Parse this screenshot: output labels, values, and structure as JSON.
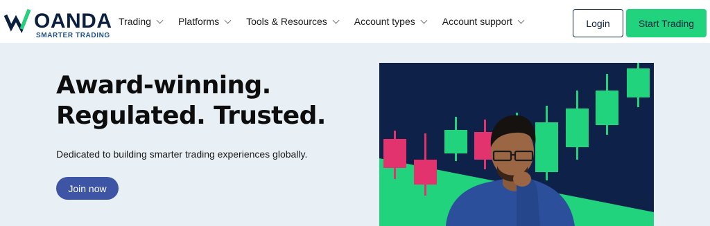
{
  "brand": {
    "name": "OANDA",
    "tagline": "SMARTER TRADING",
    "colors": {
      "navy": "#0b1f3f",
      "green": "#20d37c",
      "pink": "#e3336f",
      "join": "#3d55a4"
    }
  },
  "nav": {
    "items": [
      {
        "label": "Trading",
        "icon": "chevron-down-icon"
      },
      {
        "label": "Platforms",
        "icon": "chevron-down-icon"
      },
      {
        "label": "Tools & Resources",
        "icon": "chevron-down-icon"
      },
      {
        "label": "Account types",
        "icon": "chevron-down-icon"
      },
      {
        "label": "Account support",
        "icon": "chevron-down-icon"
      }
    ],
    "login_label": "Login",
    "start_label": "Start Trading"
  },
  "hero": {
    "title_line1": "Award-winning.",
    "title_line2": "Regulated. Trusted.",
    "subtitle": "Dedicated to building smarter trading experiences globally.",
    "cta_label": "Join now"
  }
}
